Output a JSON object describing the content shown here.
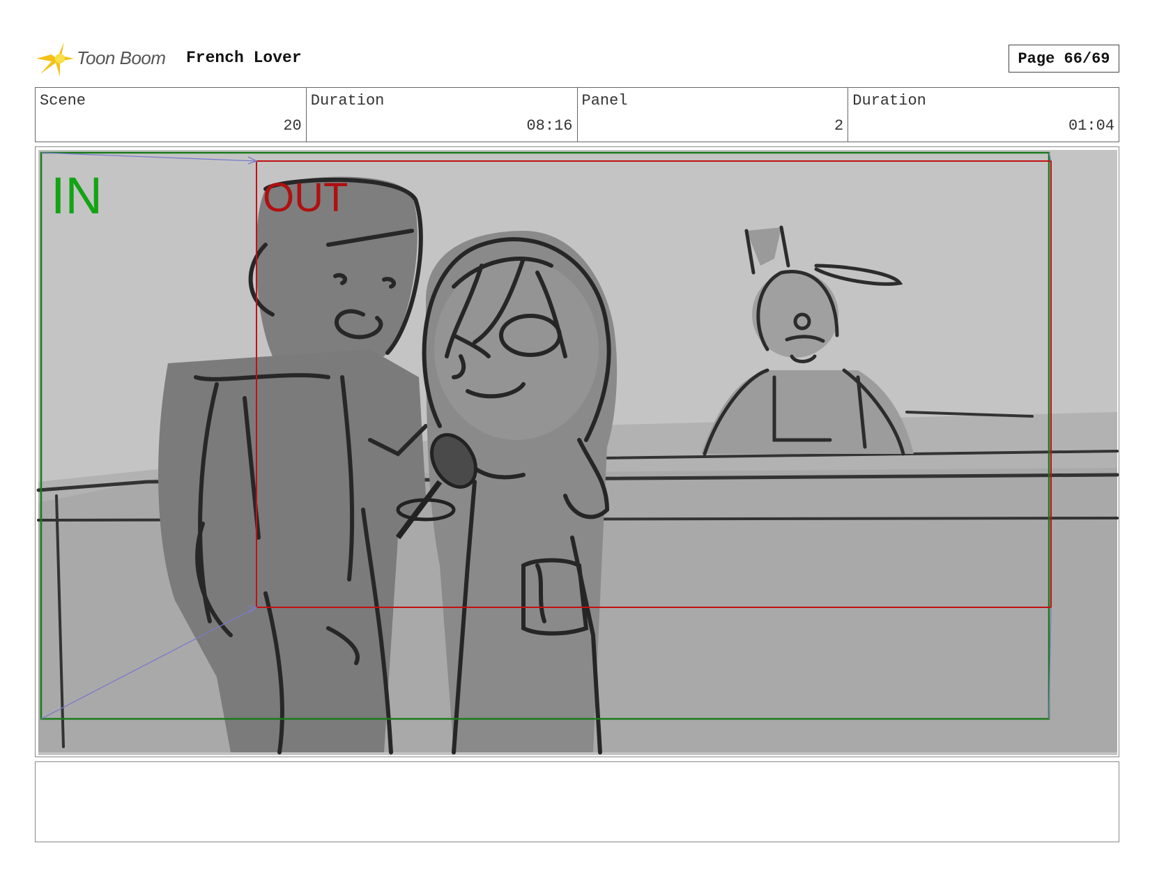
{
  "header": {
    "logo_text": "Toon Boom",
    "title": "French Lover",
    "page": "Page 66/69"
  },
  "info": {
    "scene_label": "Scene",
    "scene_value": "20",
    "duration_label": "Duration",
    "duration_value": "08:16",
    "panel_label": "Panel",
    "panel_value": "2",
    "panel_duration_label": "Duration",
    "panel_duration_value": "01:04"
  },
  "frame": {
    "in_label": "IN",
    "out_label": "OUT",
    "in_color": "#13a413",
    "out_color": "#b01010"
  },
  "notes": {
    "text": ""
  }
}
